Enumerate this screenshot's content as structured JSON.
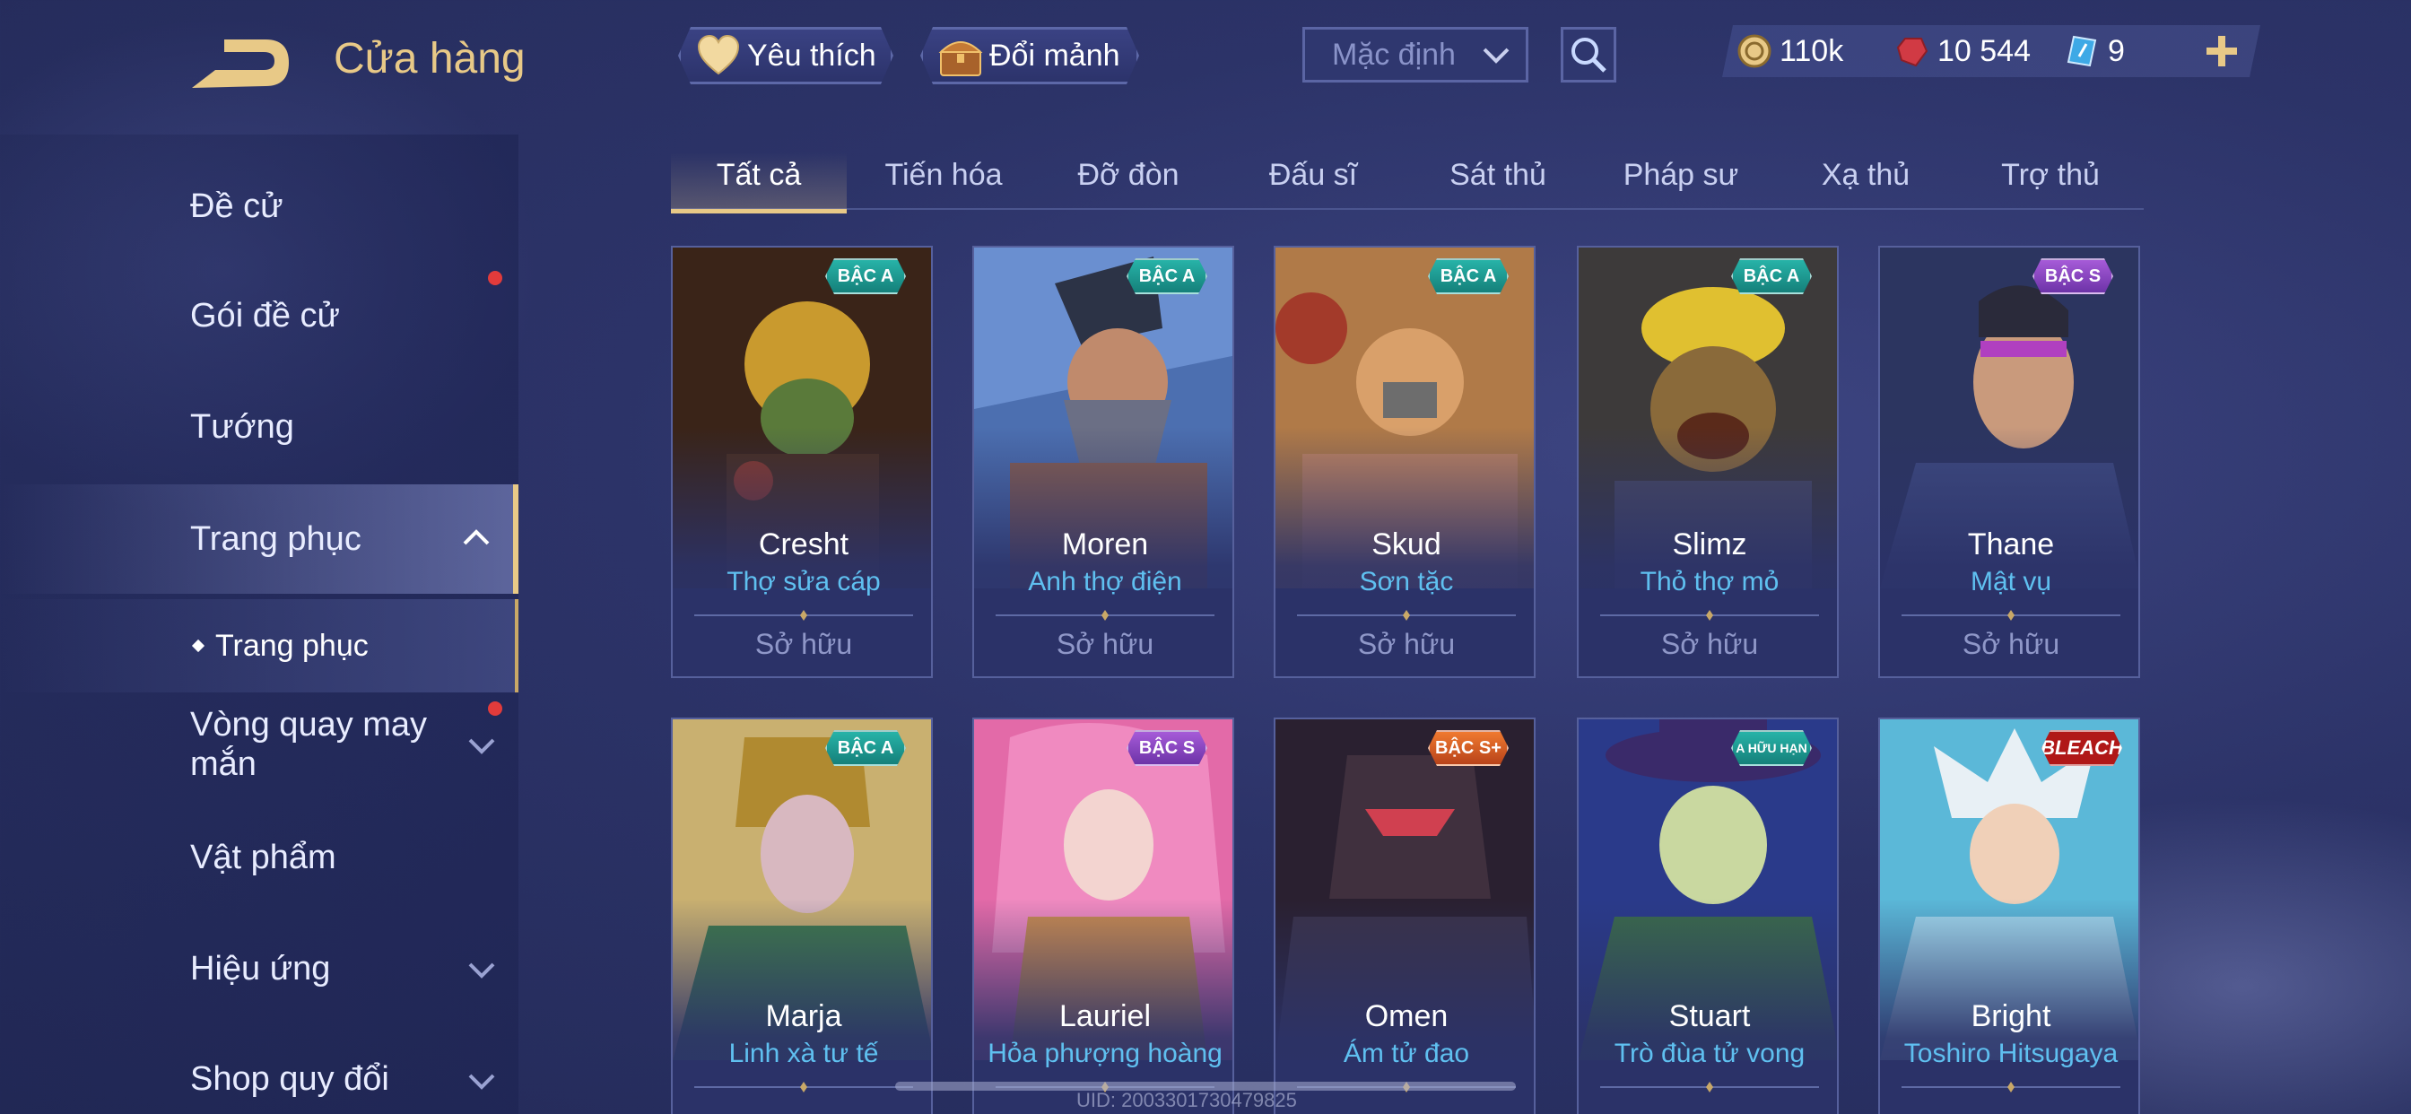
{
  "header": {
    "title": "Cửa hàng",
    "favorites_label": "Yêu thích",
    "exchange_label": "Đổi mảnh",
    "sort_value": "Mặc định"
  },
  "currency": {
    "gold": "110k",
    "ruby": "10 544",
    "voucher": "9"
  },
  "sidebar": {
    "items": [
      {
        "label": "Đề cử"
      },
      {
        "label": "Gói đề cử"
      },
      {
        "label": "Tướng"
      },
      {
        "label": "Trang phục"
      },
      {
        "label": "Vòng quay may mắn"
      },
      {
        "label": "Vật phẩm"
      },
      {
        "label": "Hiệu ứng"
      },
      {
        "label": "Shop quy đổi"
      }
    ],
    "sub_item": "Trang phục"
  },
  "tabs": [
    "Tất cả",
    "Tiến hóa",
    "Đỡ đòn",
    "Đấu sĩ",
    "Sát thủ",
    "Pháp sư",
    "Xạ thủ",
    "Trợ thủ"
  ],
  "cards": [
    {
      "name": "Cresht",
      "skin": "Thợ sửa cáp",
      "status": "Sở hữu",
      "badge": "BẬC A"
    },
    {
      "name": "Moren",
      "skin": "Anh thợ điện",
      "status": "Sở hữu",
      "badge": "BẬC A"
    },
    {
      "name": "Skud",
      "skin": "Sơn tặc",
      "status": "Sở hữu",
      "badge": "BẬC A"
    },
    {
      "name": "Slimz",
      "skin": "Thỏ thợ mỏ",
      "status": "Sở hữu",
      "badge": "BẬC A"
    },
    {
      "name": "Thane",
      "skin": "Mật vụ",
      "status": "Sở hữu",
      "badge": "BẬC S"
    },
    {
      "name": "Marja",
      "skin": "Linh xà tư tế",
      "badge": "BẬC A"
    },
    {
      "name": "Lauriel",
      "skin": "Hỏa phượng hoàng",
      "badge": "BẬC S"
    },
    {
      "name": "Omen",
      "skin": "Ám tử đao",
      "badge": "BẬC S+"
    },
    {
      "name": "Stuart",
      "skin": "Trò đùa tử vong",
      "badge": "A HỮU HẠN"
    },
    {
      "name": "Bright",
      "skin": "Toshiro Hitsugaya",
      "badge": "BLEACH"
    }
  ],
  "uid_text": "UID: 2003301730479825",
  "colors": {
    "accent_gold": "#e8c987",
    "skin_name": "#5fc0f0",
    "badge_a": "#1f9e96",
    "badge_s": "#8c47c4"
  }
}
